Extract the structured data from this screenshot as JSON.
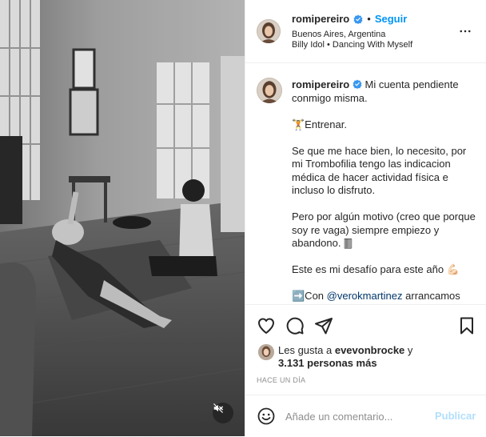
{
  "post": {
    "author": {
      "username": "romipereiro",
      "verified": true,
      "follow_label": "Seguir",
      "separator": "•",
      "location": "Buenos Aires, Argentina",
      "audio": "Billy Idol • Dancing With Myself"
    },
    "caption": {
      "username": "romipereiro",
      "intro": "Mi cuenta pendiente conmigo misma.",
      "paragraphs": [
        "🏋️Entrenar.",
        "Se que me hace bien, lo necesito, por mi Trombofilia tengo las indicacion médica de hacer actividad física e incluso lo disfruto.",
        "Pero por algún motivo (creo que porque soy re vaga) siempre empiezo y abandono. 🀫",
        "Este es mi desafío para este año 💪🏻"
      ],
      "last_line_prefix": "➡️Con",
      "last_line_mention": "@verokmartinez",
      "last_line_suffix": "arrancamos"
    },
    "likes": {
      "prefix": "Les gusta a",
      "first_user": "evevonbrocke",
      "conjunction": "y",
      "others": "3.131 personas más"
    },
    "timestamp": "HACE UN DÍA",
    "comment_box": {
      "placeholder": "Añade un comentario...",
      "publish_label": "Publicar"
    },
    "icons": {
      "verified": "verified-badge-icon",
      "more": "more-options-icon",
      "like": "heart-icon",
      "comment": "comment-icon",
      "share": "paper-plane-icon",
      "save": "bookmark-icon",
      "emoji": "emoji-icon",
      "mute": "speaker-muted-icon"
    },
    "colors": {
      "accent": "#0095f6",
      "verified": "#3897f0",
      "publish_disabled": "#b2dffc"
    }
  }
}
